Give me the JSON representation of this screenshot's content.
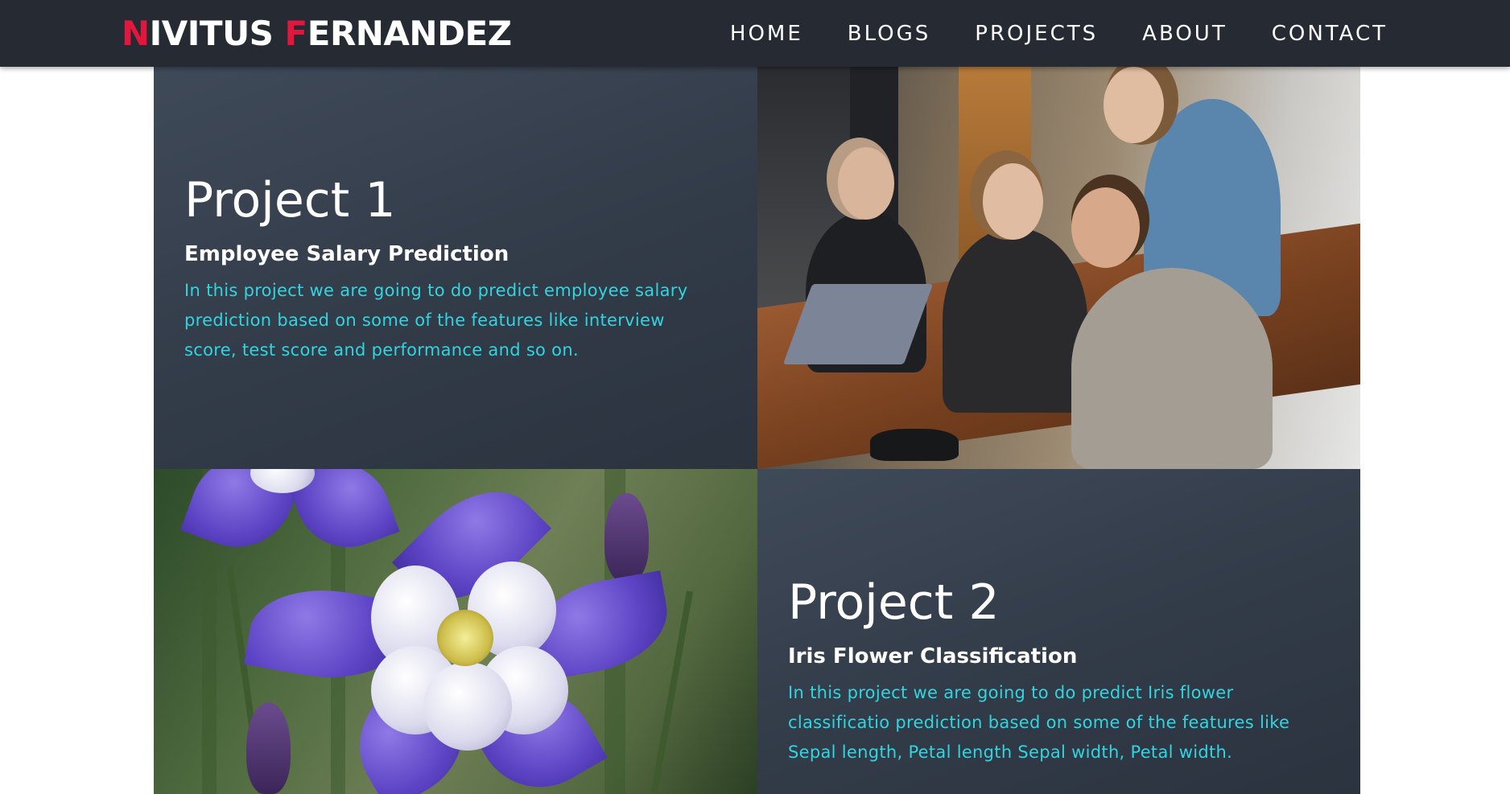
{
  "brand": {
    "first_initial": "N",
    "first_rest": "IVITUS",
    "last_initial": "F",
    "last_rest": "ERNANDEZ",
    "accent_color": "#e3163e"
  },
  "nav": {
    "items": [
      "HOME",
      "BLOGS",
      "PROJECTS",
      "ABOUT",
      "CONTACT"
    ]
  },
  "projects": [
    {
      "title": "Project 1",
      "subtitle": "Employee Salary Prediction",
      "description": "In this project we are going to do predict employee salary prediction based on some of the features like interview score, test score and performance and so on.",
      "image": "office-team-photo"
    },
    {
      "title": "Project 2",
      "subtitle": "Iris Flower Classification",
      "description": "In this project we are going to do predict Iris flower classificatio prediction based on some of the features like Sepal length, Petal length Sepal width, Petal width.",
      "image": "iris-flower-photo"
    }
  ],
  "colors": {
    "navbar": "#262b33",
    "panel": "#3a4451",
    "description_text": "#32d4df"
  }
}
